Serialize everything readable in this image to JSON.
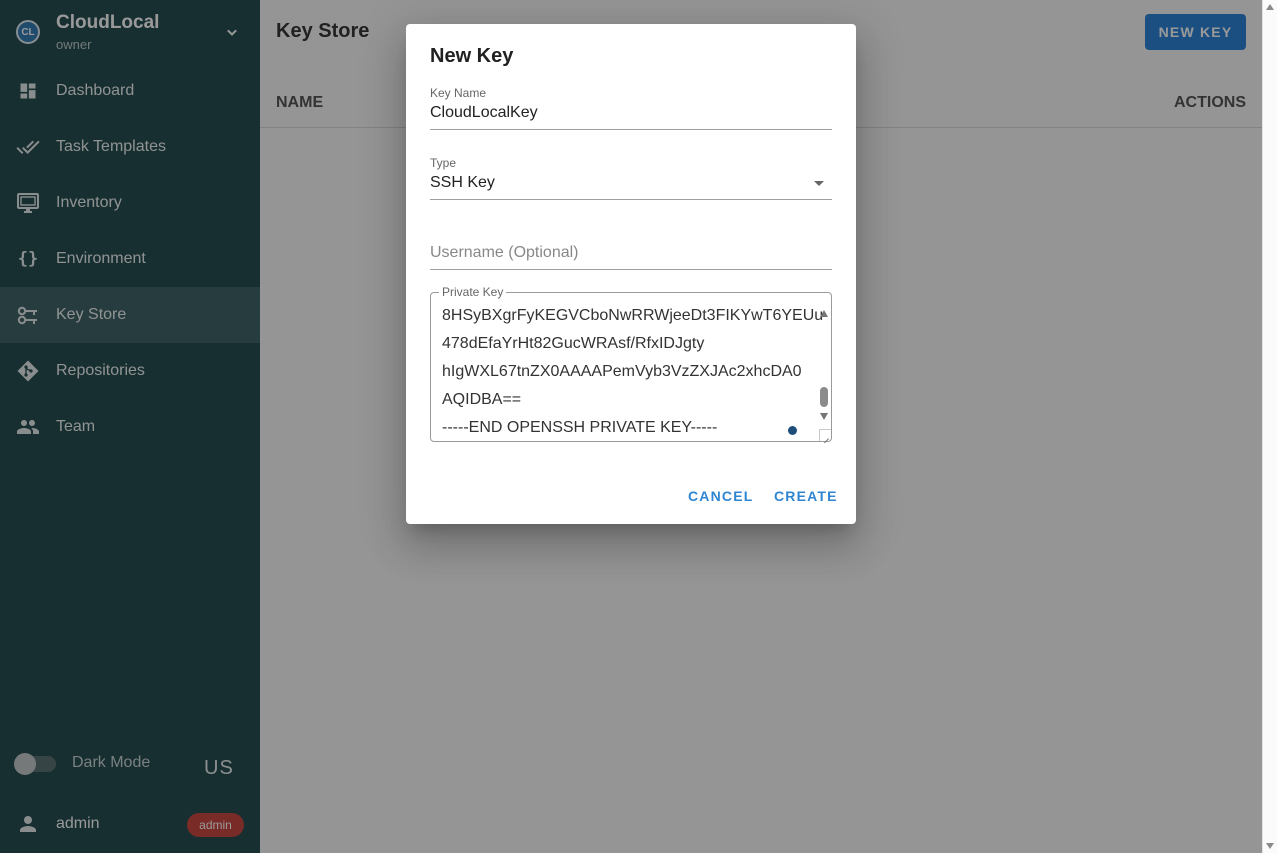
{
  "project": {
    "avatar": "CL",
    "name": "CloudLocal",
    "role": "owner"
  },
  "nav": [
    {
      "label": "Dashboard",
      "icon": "dashboard-icon"
    },
    {
      "label": "Task Templates",
      "icon": "done-all-icon"
    },
    {
      "label": "Inventory",
      "icon": "monitor-icon"
    },
    {
      "label": "Environment",
      "icon": "braces-icon"
    },
    {
      "label": "Key Store",
      "icon": "key-icon",
      "active": true
    },
    {
      "label": "Repositories",
      "icon": "git-icon"
    },
    {
      "label": "Team",
      "icon": "people-icon"
    }
  ],
  "footer": {
    "dark_mode_label": "Dark Mode",
    "language": "US",
    "user": "admin",
    "badge": "admin"
  },
  "page": {
    "title": "Key Store",
    "new_key_label": "NEW KEY",
    "columns": [
      "NAME",
      "ACTIONS"
    ]
  },
  "dialog": {
    "title": "New Key",
    "key_name_label": "Key Name",
    "key_name_value": "CloudLocalKey",
    "type_label": "Type",
    "type_value": "SSH Key",
    "username_placeholder": "Username (Optional)",
    "private_key_label": "Private Key",
    "private_key_lines": [
      "8HSyBXgrFyKEGVCboNwRRWjeeDt3FIKYwT6YEUu",
      "478dEfaYrHt82GucWRAsf/RfxIDJgty",
      "hIgWXL67tnZX0AAAAPemVyb3VzZXJAc2xhcDA0",
      "AQIDBA==",
      "-----END OPENSSH PRIVATE KEY-----"
    ],
    "cancel_label": "CANCEL",
    "create_label": "CREATE"
  },
  "colors": {
    "sidebar": "#0f3b3f",
    "accent": "#1976d2",
    "badge": "#c4352f"
  }
}
